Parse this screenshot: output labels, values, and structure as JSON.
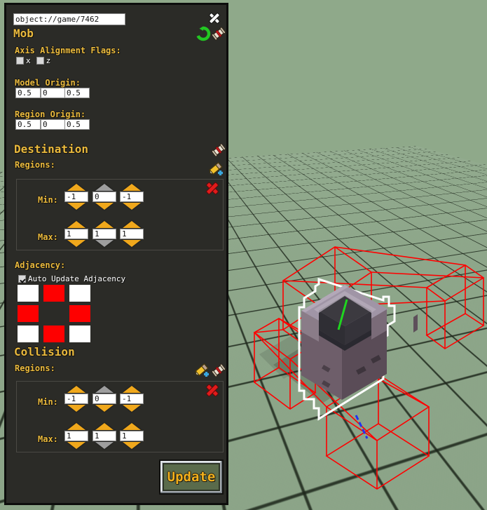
{
  "viewport": {
    "name": "3d-viewport",
    "ground_color": "#8ea88a",
    "grid_line_color": "#1a2316",
    "selection_outline_color": "#ffffff",
    "region_wireframe_color": "#ff0000",
    "axis_y_color": "#1fd61f",
    "axis_z_color": "#2233ee",
    "model_color": "#8b7f8c"
  },
  "panel": {
    "url_field": {
      "value": "object://game/7462",
      "placeholder": "object://"
    },
    "close_label": "×",
    "title": "Mob",
    "toolbar": {
      "revert_icon": "revert-icon",
      "script_icon": "scroll-icon"
    },
    "axis_flags": {
      "label": "Axis Alignment Flags:",
      "items": [
        {
          "label": "x",
          "checked": false
        },
        {
          "label": "z",
          "checked": false
        }
      ]
    },
    "model_origin": {
      "label": "Model Origin:",
      "values": [
        "0.5",
        "0",
        "0.5"
      ]
    },
    "region_origin": {
      "label": "Region Origin:",
      "values": [
        "0.5",
        "0",
        "0.5"
      ]
    },
    "destination": {
      "heading": "Destination",
      "regions_label": "Regions:",
      "region": {
        "min_label": "Min:",
        "max_label": "Max:",
        "min": [
          {
            "value": "-1",
            "up_enabled": true,
            "down_enabled": true
          },
          {
            "value": "0",
            "up_enabled": false,
            "down_enabled": true
          },
          {
            "value": "-1",
            "up_enabled": true,
            "down_enabled": true
          }
        ],
        "max": [
          {
            "value": "1",
            "up_enabled": true,
            "down_enabled": true
          },
          {
            "value": "1",
            "up_enabled": true,
            "down_enabled": false
          },
          {
            "value": "1",
            "up_enabled": true,
            "down_enabled": true
          }
        ]
      }
    },
    "adjacency": {
      "heading": "Adjacency:",
      "auto_update_label": "Auto Update Adjacency",
      "auto_update_checked": true,
      "grid": [
        [
          "white",
          "red",
          "white"
        ],
        [
          "red",
          "empty",
          "red"
        ],
        [
          "white",
          "red",
          "white"
        ]
      ]
    },
    "collision": {
      "heading": "Collision",
      "regions_label": "Regions:",
      "region": {
        "min_label": "Min:",
        "max_label": "Max:",
        "min": [
          {
            "value": "-1",
            "up_enabled": true,
            "down_enabled": true
          },
          {
            "value": "0",
            "up_enabled": false,
            "down_enabled": true
          },
          {
            "value": "-1",
            "up_enabled": true,
            "down_enabled": true
          }
        ],
        "max": [
          {
            "value": "1",
            "up_enabled": true,
            "down_enabled": true
          },
          {
            "value": "1",
            "up_enabled": true,
            "down_enabled": false
          },
          {
            "value": "1",
            "up_enabled": true,
            "down_enabled": true
          }
        ]
      }
    },
    "update_button": "Update"
  },
  "colors": {
    "panel_bg": "#2b2b27",
    "label_gold": "#e9b93d",
    "arrow_enabled": "#f0a81c",
    "arrow_disabled": "#9e9e9e",
    "adjacency_red": "#fe0000",
    "delete_red": "#e01b1b"
  }
}
